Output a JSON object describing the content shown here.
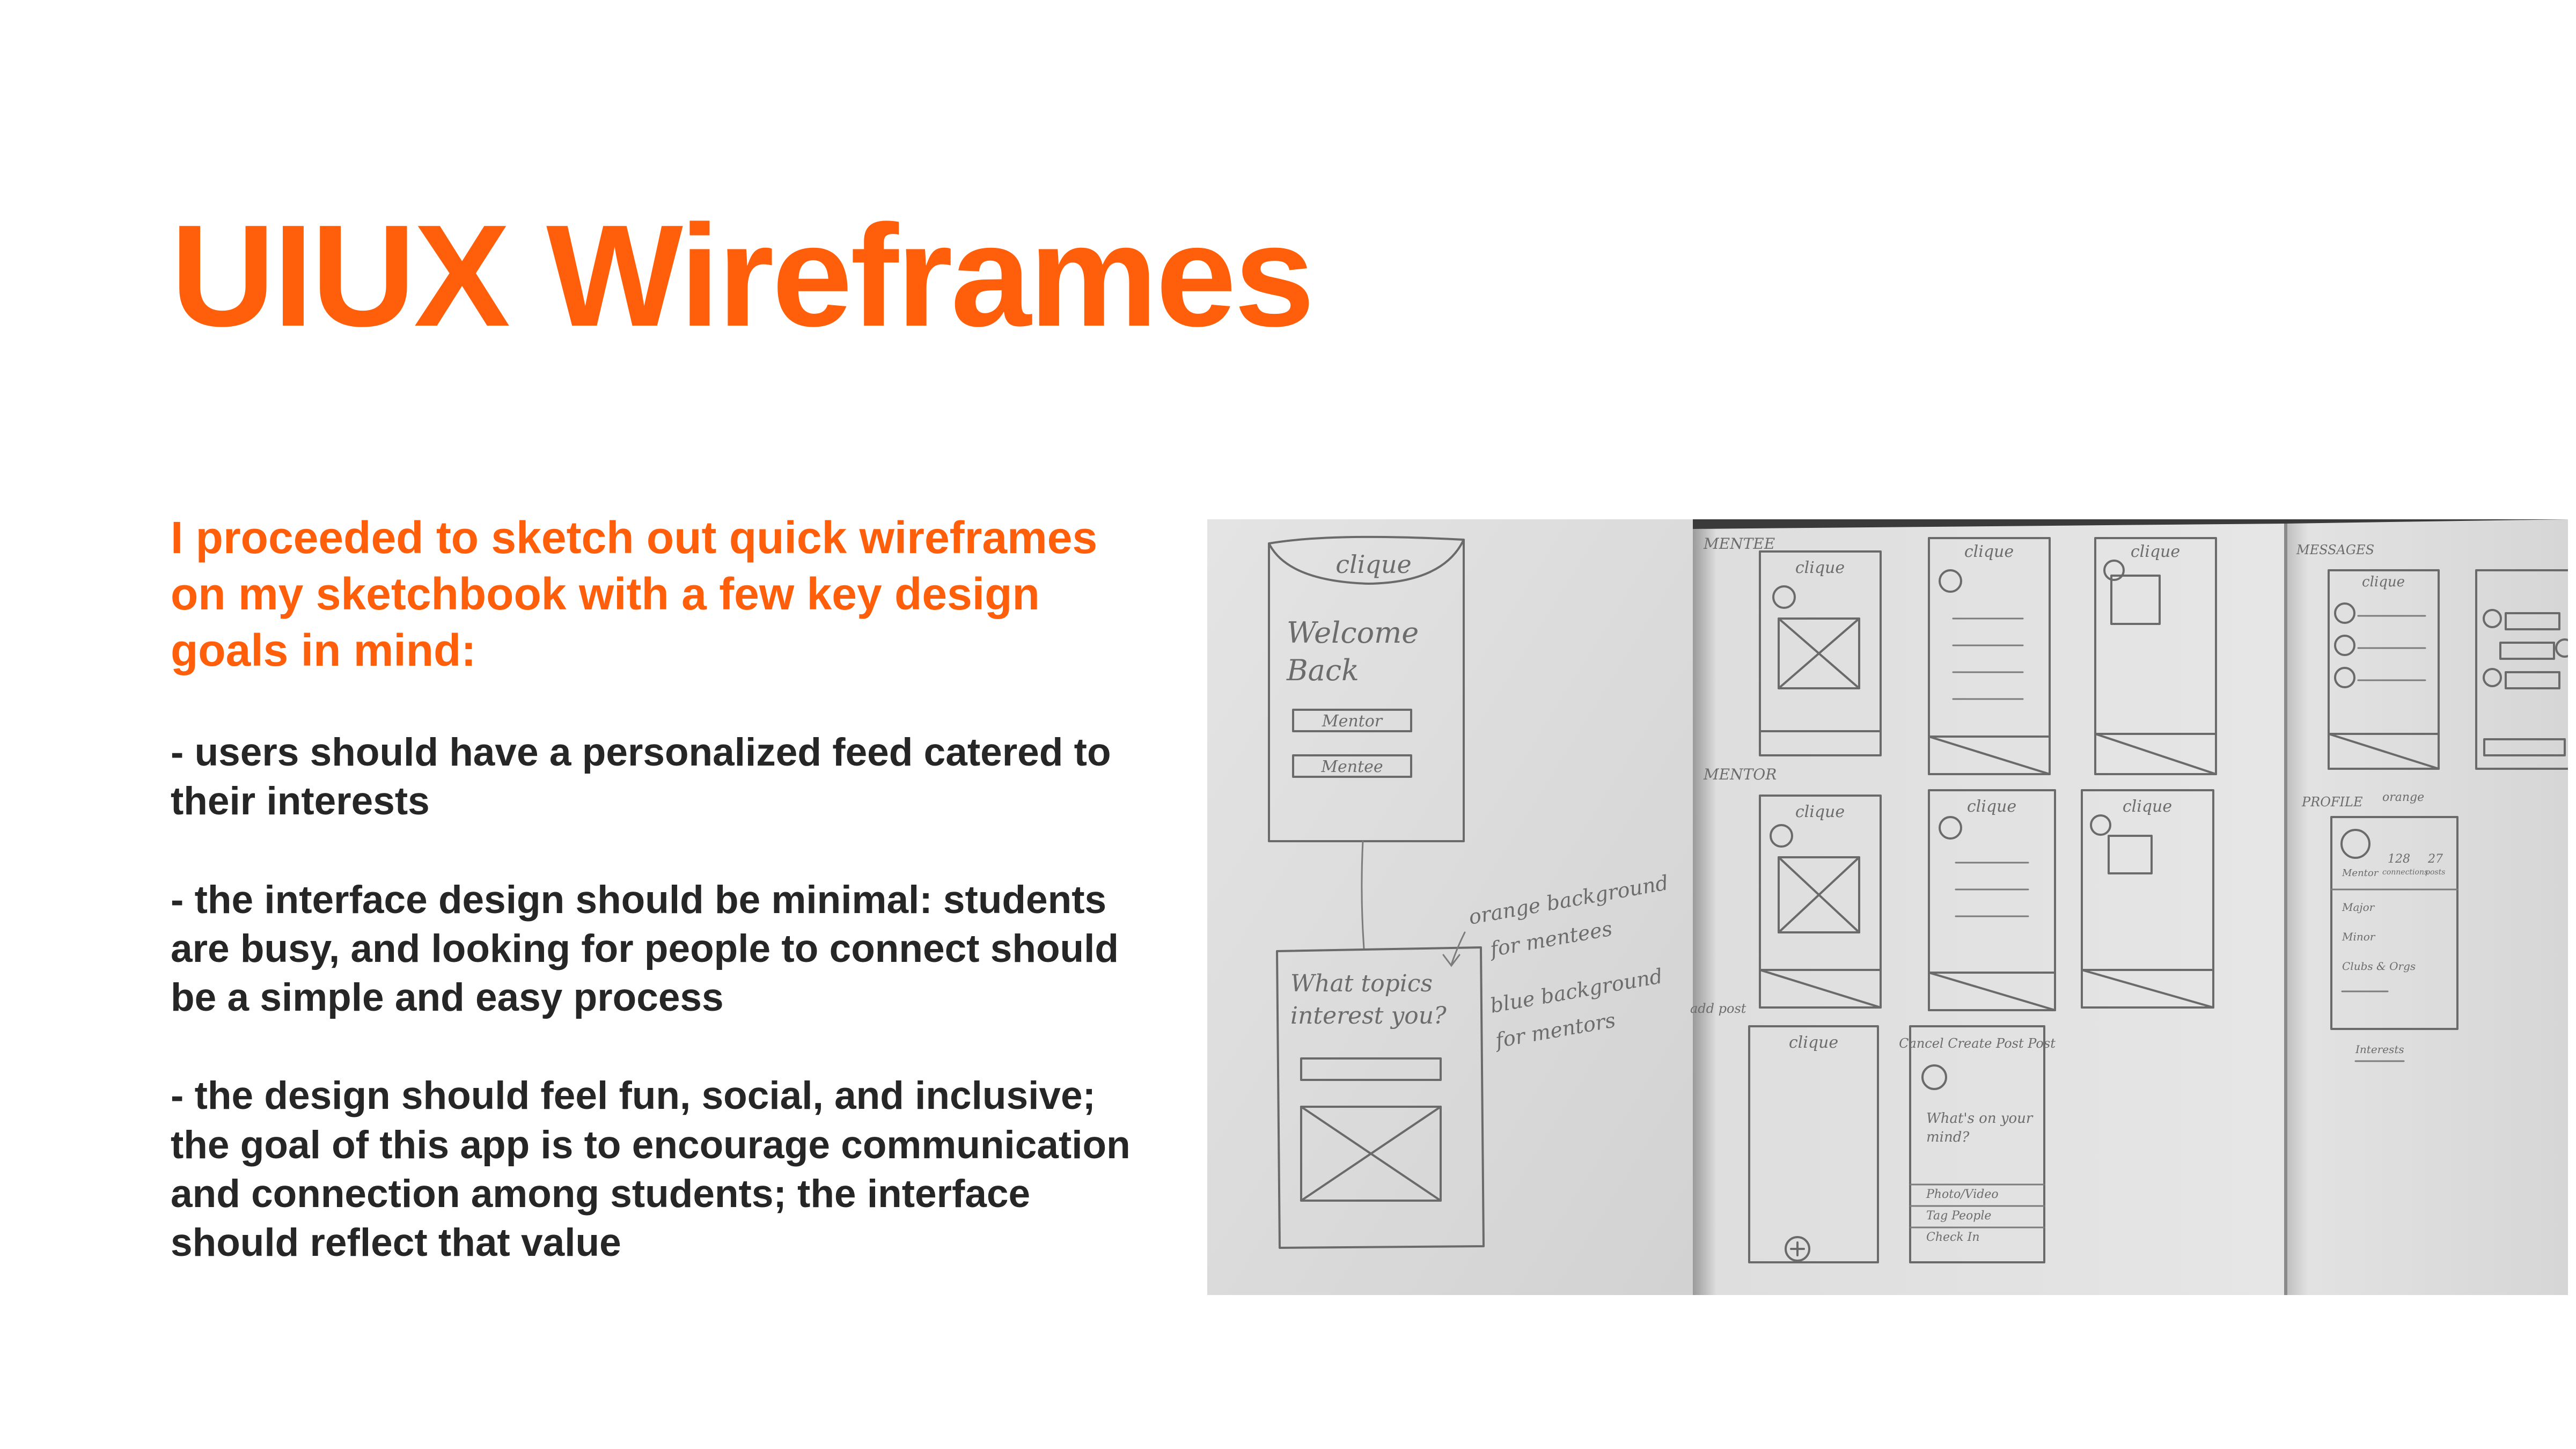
{
  "slide": {
    "title": "UIUX Wireframes",
    "intro": "I proceeded to sketch out quick wireframes on my sketchbook with a few key design goals in mind:",
    "goals": [
      "- users should have a personalized feed catered to their interests",
      "- the interface design should be minimal: students are busy, and looking for people to connect should be a simple and easy process",
      "- the design should feel fun, social, and inclusive; the goal of this app is to encourage communication and connection among students; the interface should reflect that value"
    ]
  },
  "sketch": {
    "login": {
      "logo": "clique",
      "welcome": "Welcome",
      "back": "Back",
      "mentor_button": "Mentor",
      "mentee_button": "Mentee"
    },
    "topics": {
      "question_line1": "What topics",
      "question_line2": "interest you?"
    },
    "notes": {
      "orange_line1": "orange background",
      "orange_line2": "for mentees",
      "blue_line1": "blue background",
      "blue_line2": "for mentors"
    },
    "section_labels": {
      "mentee": "MENTEE",
      "mentor": "MENTOR",
      "messages": "MESSAGES",
      "profile": "PROFILE",
      "add_post": "add post"
    },
    "feed_logo": "clique",
    "create_post": {
      "header": "Cancel  Create Post  Post",
      "prompt_line1": "What's on your",
      "prompt_line2": "mind?",
      "option_photo": "Photo/Video",
      "option_tag": "Tag People",
      "option_checkin": "Check In"
    },
    "profile": {
      "note": "orange",
      "role": "Mentor",
      "connections": "128",
      "connections_label": "connections",
      "posts": "27",
      "posts_label": "posts",
      "major": "Major",
      "minor": "Minor",
      "clubs": "Clubs & Orgs",
      "interests": "Interests"
    }
  }
}
